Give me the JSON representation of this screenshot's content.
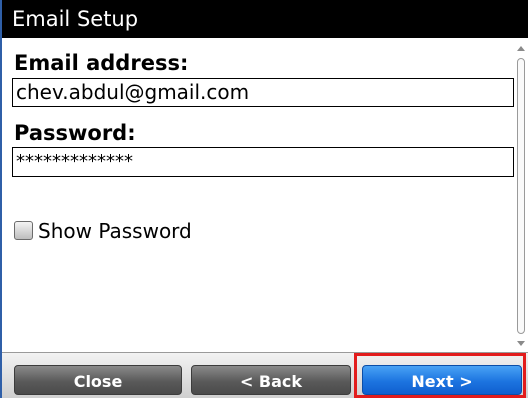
{
  "window": {
    "title": "Email Setup"
  },
  "form": {
    "email_label": "Email address:",
    "email_value": "chev.abdul@gmail.com",
    "password_label": "Password:",
    "password_value": "*************",
    "show_password_label": "Show Password",
    "show_password_checked": false
  },
  "buttons": {
    "close": "Close",
    "back": "< Back",
    "next": "Next >"
  },
  "colors": {
    "title_bar": "#000000",
    "primary_button": "#1c74e0",
    "secondary_button": "#5a5a5a",
    "highlight": "#e21c1c"
  }
}
